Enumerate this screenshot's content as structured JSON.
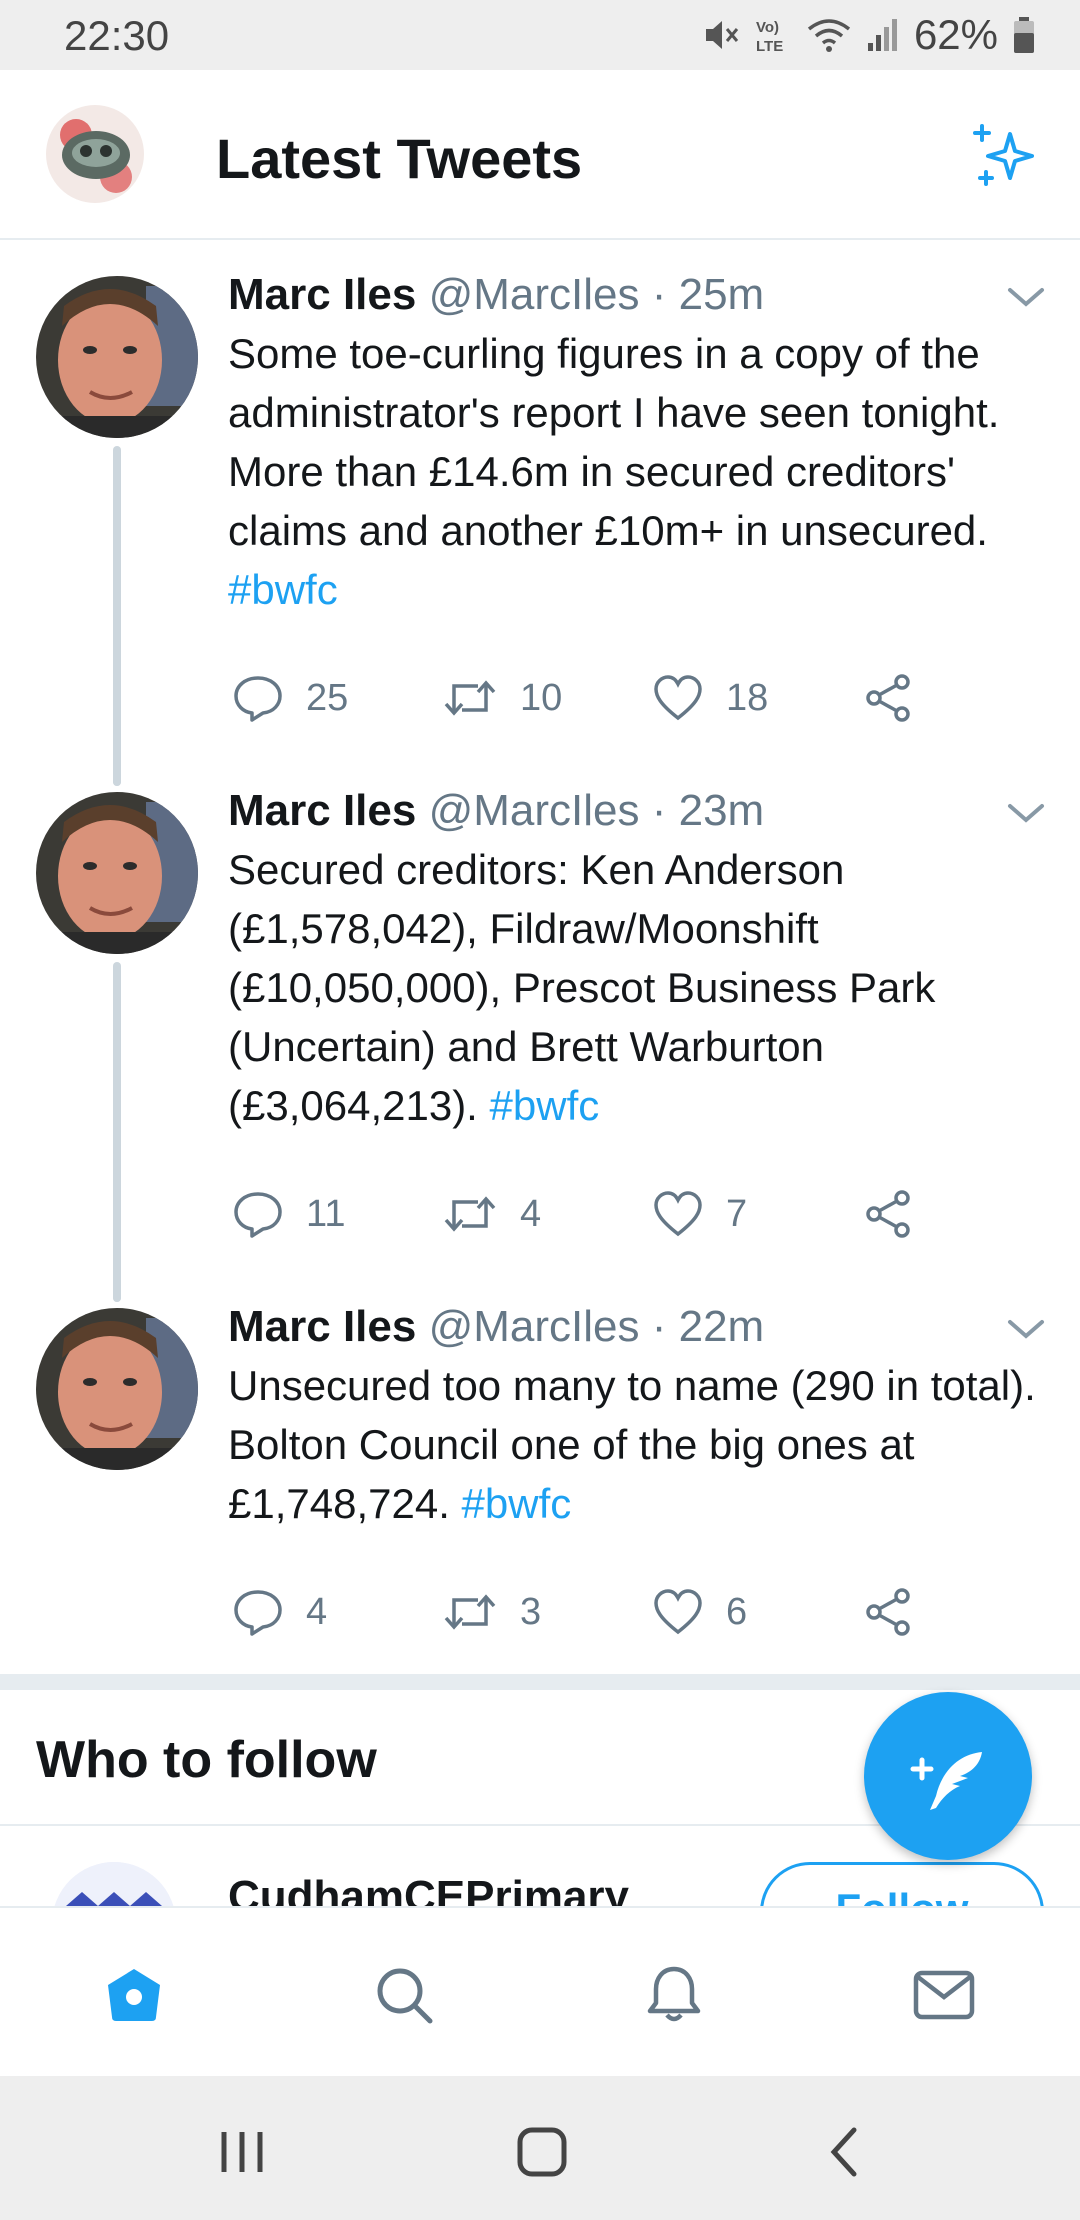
{
  "status_bar": {
    "time": "22:30",
    "battery_percent": "62%",
    "icons": [
      "mute-icon",
      "volte-icon",
      "wifi-icon",
      "signal-icon",
      "battery-icon"
    ]
  },
  "header": {
    "title": "Latest Tweets",
    "profile_icon": "profile-avatar",
    "action_icon": "sparkle-icon"
  },
  "tweets": [
    {
      "name": "Marc Iles",
      "handle": "@MarcIles",
      "time": "· 25m",
      "text": "Some toe-curling figures in a copy of the administrator's report I have seen tonight. More than £14.6m in secured creditors' claims and another £10m+ in unsecured. ",
      "hashtag": "#bwfc",
      "replies": "25",
      "retweets": "10",
      "likes": "18"
    },
    {
      "name": "Marc Iles",
      "handle": "@MarcIles",
      "time": "· 23m",
      "text": "Secured creditors: Ken Anderson (£1,578,042), Fildraw/Moonshift (£10,050,000), Prescot Business Park (Uncertain) and Brett Warburton (£3,064,213). ",
      "hashtag": "#bwfc",
      "replies": "11",
      "retweets": "4",
      "likes": "7"
    },
    {
      "name": "Marc Iles",
      "handle": "@MarcIles",
      "time": "· 22m",
      "text": "Unsecured too many to name (290 in total). Bolton Council one of the big ones at £1,748,724. ",
      "hashtag": "#bwfc",
      "replies": "4",
      "retweets": "3",
      "likes": "6"
    }
  ],
  "who_to_follow": {
    "title": "Who to follow",
    "suggestion_name": "CudhamCEPrimary",
    "follow_label": "Follow"
  },
  "bottom_nav": [
    "home-icon",
    "search-icon",
    "notifications-icon",
    "messages-icon"
  ],
  "system_nav": [
    "recent-apps-icon",
    "home-button-icon",
    "back-icon"
  ],
  "colors": {
    "accent": "#1da1f2",
    "text": "#14171a",
    "muted": "#657786",
    "divider": "#e6ecf0"
  }
}
